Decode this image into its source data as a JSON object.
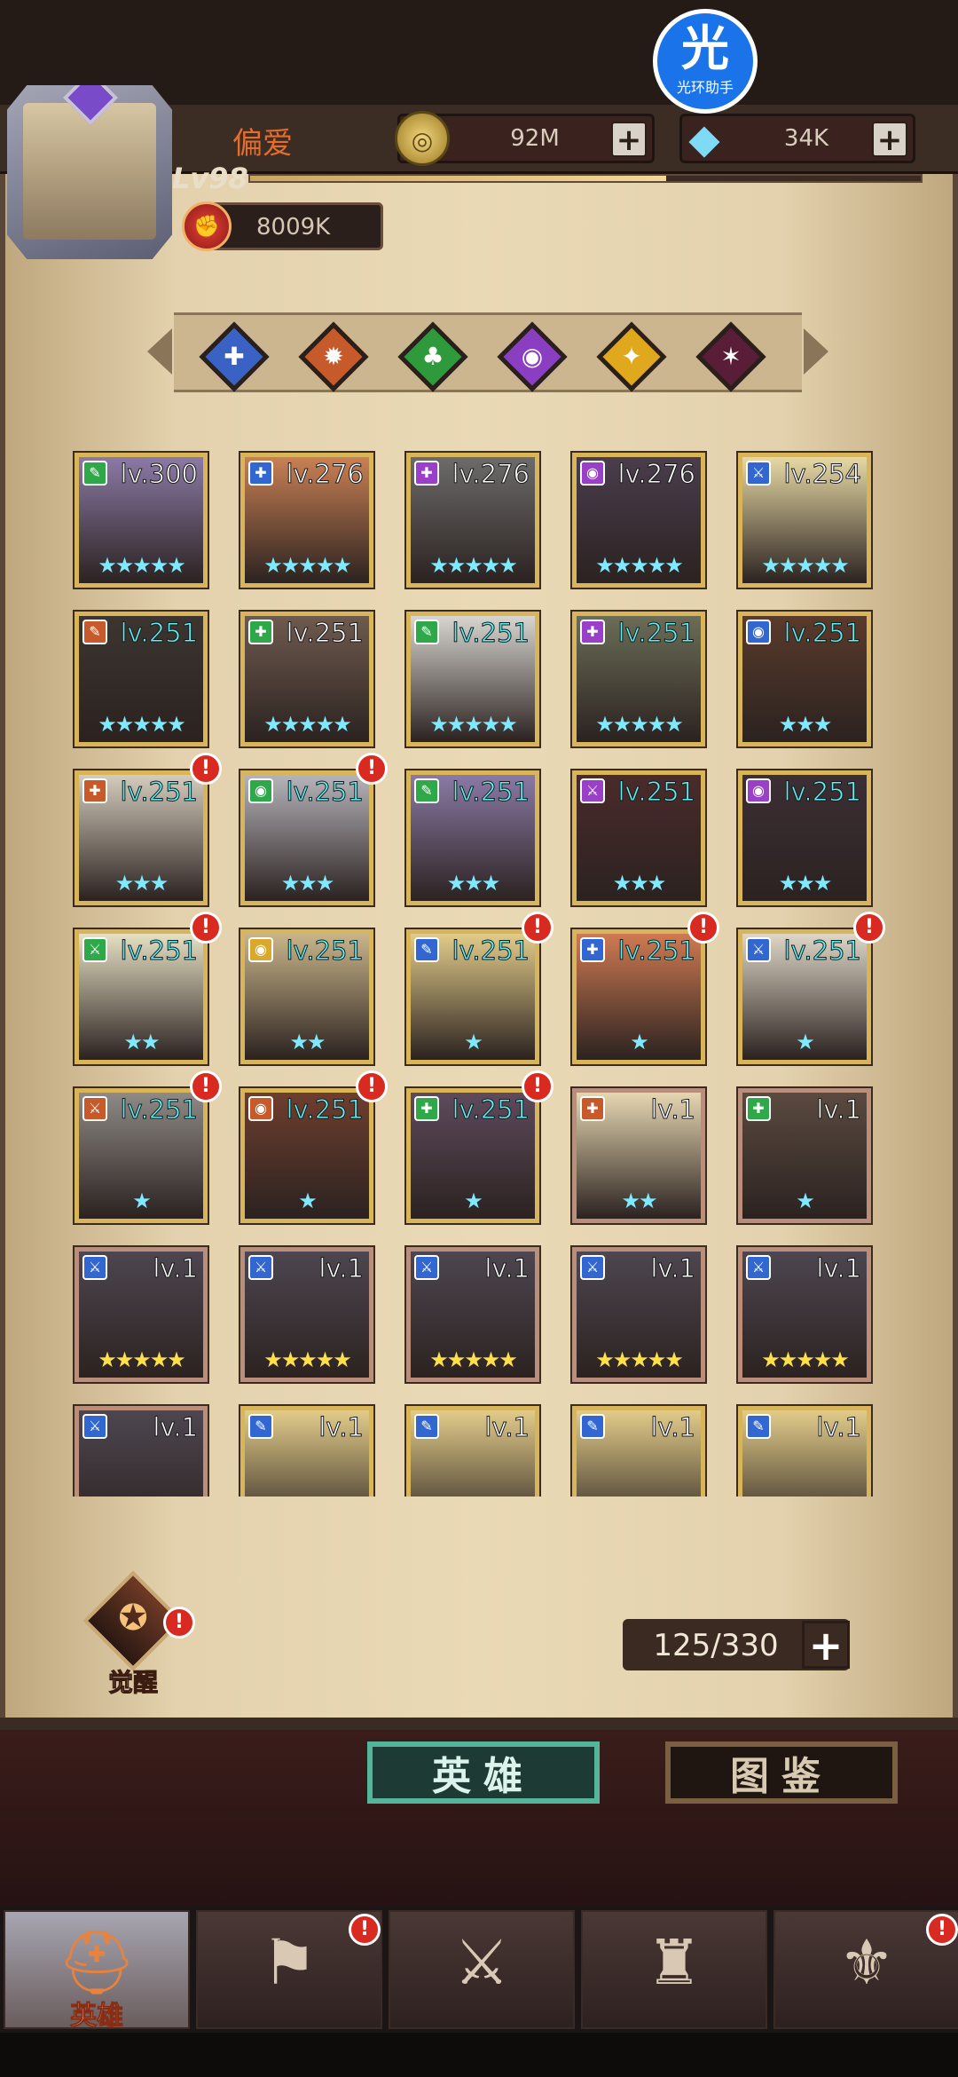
{
  "player": {
    "name": "偏爱",
    "level_label": "Lv98",
    "xp_fraction": 0.62,
    "power": "8009K"
  },
  "resources": {
    "gold": "92M",
    "gems": "34K"
  },
  "helper": {
    "icon_char": "光",
    "label": "光环助手"
  },
  "class_filters": [
    {
      "icon": "staff-class-icon",
      "color": "#3a62c4",
      "glyph": "✚"
    },
    {
      "icon": "sun-class-icon",
      "color": "#c65a2a",
      "glyph": "✹"
    },
    {
      "icon": "clover-class-icon",
      "color": "#2f9a3c",
      "glyph": "♣"
    },
    {
      "icon": "eye-class-icon",
      "color": "#8a3fc3",
      "glyph": "◉"
    },
    {
      "icon": "star-class-icon",
      "color": "#e0a81c",
      "glyph": "✦"
    },
    {
      "icon": "rune-class-icon",
      "color": "#5a1d38",
      "glyph": "✶"
    }
  ],
  "heroes": [
    {
      "level": "lv.300",
      "cls": "#2fa84a",
      "sym": "✎",
      "stars": "★★★★★",
      "star_color": "blue",
      "frame": "gold",
      "portrait": "#8b7aa6",
      "cyan": false,
      "alert": false
    },
    {
      "level": "lv.276",
      "cls": "#3267d2",
      "sym": "✚",
      "stars": "★★★★★",
      "star_color": "blue",
      "frame": "gold",
      "portrait": "#c98054",
      "cyan": false,
      "alert": false
    },
    {
      "level": "lv.276",
      "cls": "#9a3fc8",
      "sym": "✚",
      "stars": "★★★★★",
      "star_color": "blue",
      "frame": "gold",
      "portrait": "#6c6b6a",
      "cyan": false,
      "alert": false
    },
    {
      "level": "lv.276",
      "cls": "#9a3fc8",
      "sym": "◉",
      "stars": "★★★★★",
      "star_color": "blue",
      "frame": "gold",
      "portrait": "#4a3d4d",
      "cyan": false,
      "alert": false
    },
    {
      "level": "lv.254",
      "cls": "#3267d2",
      "sym": "⚔",
      "stars": "★★★★★",
      "star_color": "blue",
      "frame": "gold",
      "portrait": "#e7d9a5",
      "cyan": false,
      "alert": false
    },
    {
      "level": "lv.251",
      "cls": "#c65a2a",
      "sym": "✎",
      "stars": "★★★★★",
      "star_color": "blue",
      "frame": "gold",
      "portrait": "#3c3530",
      "cyan": true,
      "alert": false
    },
    {
      "level": "lv.251",
      "cls": "#2fa84a",
      "sym": "✚",
      "stars": "★★★★★",
      "star_color": "blue",
      "frame": "gold",
      "portrait": "#6e5a4e",
      "cyan": false,
      "alert": false
    },
    {
      "level": "lv.251",
      "cls": "#2fa84a",
      "sym": "✎",
      "stars": "★★★★★",
      "star_color": "blue",
      "frame": "gold",
      "portrait": "#d8d6d0",
      "cyan": true,
      "alert": false
    },
    {
      "level": "lv.251",
      "cls": "#9a3fc8",
      "sym": "✚",
      "stars": "★★★★★",
      "star_color": "blue",
      "frame": "gold",
      "portrait": "#6b6d57",
      "cyan": true,
      "alert": false
    },
    {
      "level": "lv.251",
      "cls": "#3267d2",
      "sym": "◉",
      "stars": "★★★",
      "star_color": "blue",
      "frame": "gold",
      "portrait": "#5a3a2b",
      "cyan": true,
      "alert": false
    },
    {
      "level": "lv.251",
      "cls": "#c65a2a",
      "sym": "✚",
      "stars": "★★★",
      "star_color": "blue",
      "frame": "gold",
      "portrait": "#d4ccbd",
      "cyan": true,
      "alert": true
    },
    {
      "level": "lv.251",
      "cls": "#2fa84a",
      "sym": "◉",
      "stars": "★★★",
      "star_color": "blue",
      "frame": "gold",
      "portrait": "#b6b4bb",
      "cyan": true,
      "alert": true
    },
    {
      "level": "lv.251",
      "cls": "#2fa84a",
      "sym": "✎",
      "stars": "★★★",
      "star_color": "blue",
      "frame": "gold",
      "portrait": "#8b7aa6",
      "cyan": true,
      "alert": false
    },
    {
      "level": "lv.251",
      "cls": "#9a3fc8",
      "sym": "⚔",
      "stars": "★★★",
      "star_color": "blue",
      "frame": "gold",
      "portrait": "#4a2b2b",
      "cyan": true,
      "alert": false
    },
    {
      "level": "lv.251",
      "cls": "#9a3fc8",
      "sym": "◉",
      "stars": "★★★",
      "star_color": "blue",
      "frame": "gold",
      "portrait": "#3c2f35",
      "cyan": true,
      "alert": false
    },
    {
      "level": "lv.251",
      "cls": "#2fa84a",
      "sym": "⚔",
      "stars": "★★",
      "star_color": "blue",
      "frame": "gold",
      "portrait": "#e6e0c4",
      "cyan": true,
      "alert": true
    },
    {
      "level": "lv.251",
      "cls": "#d8a92a",
      "sym": "◉",
      "stars": "★★",
      "star_color": "blue",
      "frame": "gold",
      "portrait": "#c9b58a",
      "cyan": true,
      "alert": false
    },
    {
      "level": "lv.251",
      "cls": "#3267d2",
      "sym": "✎",
      "stars": "★",
      "star_color": "blue",
      "frame": "gold",
      "portrait": "#e2cc8a",
      "cyan": true,
      "alert": true
    },
    {
      "level": "lv.251",
      "cls": "#3267d2",
      "sym": "✚",
      "stars": "★",
      "star_color": "blue",
      "frame": "gold",
      "portrait": "#cf7a52",
      "cyan": true,
      "alert": true
    },
    {
      "level": "lv.251",
      "cls": "#3267d2",
      "sym": "⚔",
      "stars": "★",
      "star_color": "blue",
      "frame": "gold",
      "portrait": "#ded6c6",
      "cyan": true,
      "alert": true
    },
    {
      "level": "lv.251",
      "cls": "#c65a2a",
      "sym": "⚔",
      "stars": "★",
      "star_color": "blue",
      "frame": "gold",
      "portrait": "#8f8a86",
      "cyan": true,
      "alert": true
    },
    {
      "level": "lv.251",
      "cls": "#c65a2a",
      "sym": "◉",
      "stars": "★",
      "star_color": "blue",
      "frame": "gold",
      "portrait": "#6e3e2e",
      "cyan": true,
      "alert": true
    },
    {
      "level": "lv.251",
      "cls": "#2fa84a",
      "sym": "✚",
      "stars": "★",
      "star_color": "blue",
      "frame": "gold",
      "portrait": "#5e4a5c",
      "cyan": true,
      "alert": true
    },
    {
      "level": "lv.1",
      "cls": "#c65a2a",
      "sym": "✚",
      "stars": "★★",
      "star_color": "blue",
      "frame": "pale",
      "portrait": "#e6d7b2",
      "cyan": false,
      "alert": false
    },
    {
      "level": "lv.1",
      "cls": "#2fa84a",
      "sym": "✚",
      "stars": "★",
      "star_color": "blue",
      "frame": "pale",
      "portrait": "#5a4a40",
      "cyan": false,
      "alert": false
    },
    {
      "level": "lv.1",
      "cls": "#3267d2",
      "sym": "⚔",
      "stars": "★★★★★",
      "star_color": "gold",
      "frame": "pale",
      "portrait": "#4e4650",
      "cyan": false,
      "alert": false
    },
    {
      "level": "lv.1",
      "cls": "#3267d2",
      "sym": "⚔",
      "stars": "★★★★★",
      "star_color": "gold",
      "frame": "pale",
      "portrait": "#4e4650",
      "cyan": false,
      "alert": false
    },
    {
      "level": "lv.1",
      "cls": "#3267d2",
      "sym": "⚔",
      "stars": "★★★★★",
      "star_color": "gold",
      "frame": "pale",
      "portrait": "#4e4650",
      "cyan": false,
      "alert": false
    },
    {
      "level": "lv.1",
      "cls": "#3267d2",
      "sym": "⚔",
      "stars": "★★★★★",
      "star_color": "gold",
      "frame": "pale",
      "portrait": "#4e4650",
      "cyan": false,
      "alert": false
    },
    {
      "level": "lv.1",
      "cls": "#3267d2",
      "sym": "⚔",
      "stars": "★★★★★",
      "star_color": "gold",
      "frame": "pale",
      "portrait": "#4e4650",
      "cyan": false,
      "alert": false
    },
    {
      "level": "lv.1",
      "cls": "#3267d2",
      "sym": "⚔",
      "stars": "",
      "star_color": "gold",
      "frame": "pale",
      "portrait": "#4e4650",
      "cyan": false,
      "alert": false
    },
    {
      "level": "lv.1",
      "cls": "#3267d2",
      "sym": "✎",
      "stars": "",
      "star_color": "gold",
      "frame": "gold",
      "portrait": "#e2cc8a",
      "cyan": false,
      "alert": false
    },
    {
      "level": "lv.1",
      "cls": "#3267d2",
      "sym": "✎",
      "stars": "",
      "star_color": "gold",
      "frame": "gold",
      "portrait": "#e2cc8a",
      "cyan": false,
      "alert": false
    },
    {
      "level": "lv.1",
      "cls": "#3267d2",
      "sym": "✎",
      "stars": "",
      "star_color": "gold",
      "frame": "gold",
      "portrait": "#e2cc8a",
      "cyan": false,
      "alert": false
    },
    {
      "level": "lv.1",
      "cls": "#3267d2",
      "sym": "✎",
      "stars": "",
      "star_color": "gold",
      "frame": "gold",
      "portrait": "#e2cc8a",
      "cyan": false,
      "alert": false
    }
  ],
  "awaken": {
    "label": "觉醒",
    "glyph": "✪"
  },
  "capacity": "125/330",
  "tabs": {
    "heroes": "英雄",
    "codex": "图鉴"
  },
  "nav": [
    {
      "icon": "helmet-icon",
      "glyph": "⛑",
      "label": "英雄",
      "active": true,
      "alert": false
    },
    {
      "icon": "flag-icon",
      "glyph": "⚑",
      "label": "",
      "active": false,
      "alert": true
    },
    {
      "icon": "crossed-swords-icon",
      "glyph": "⚔",
      "label": "",
      "active": false,
      "alert": false
    },
    {
      "icon": "castle-icon",
      "glyph": "♜",
      "label": "",
      "active": false,
      "alert": false
    },
    {
      "icon": "guild-icon",
      "glyph": "⚜",
      "label": "",
      "active": false,
      "alert": true
    }
  ],
  "alert_mark": "!",
  "plus_mark": "+"
}
